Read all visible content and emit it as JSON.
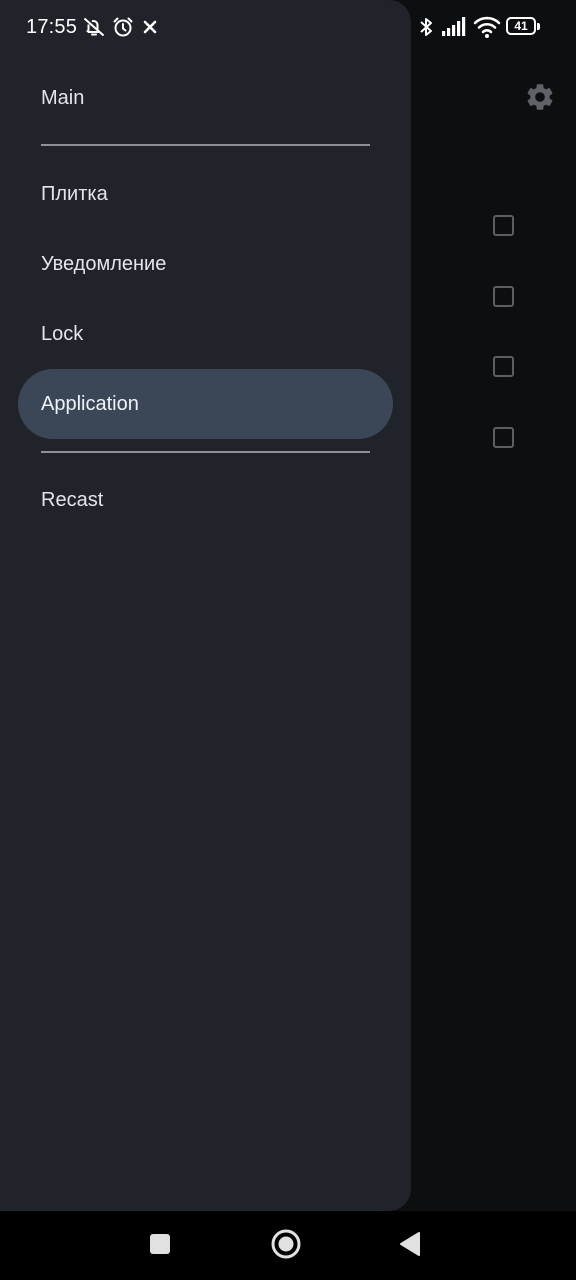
{
  "status_bar": {
    "time": "17:55",
    "battery_level": "41",
    "icons": [
      "muted-bell-icon",
      "alarm-icon",
      "close-x-icon",
      "bluetooth-icon",
      "signal-icon",
      "wifi-icon",
      "battery-icon"
    ]
  },
  "drawer": {
    "items": [
      {
        "label": "Main",
        "active": false
      },
      {
        "label": "Плитка",
        "active": false
      },
      {
        "label": "Уведомление",
        "active": false
      },
      {
        "label": "Lock",
        "active": false
      },
      {
        "label": "Application",
        "active": true
      },
      {
        "label": "Recast",
        "active": false
      }
    ],
    "active_color": "#3b4757",
    "background_color": "#202329"
  },
  "background_app": {
    "icons": [
      "settings-gear-icon"
    ],
    "checkboxes": [
      {
        "checked": false
      },
      {
        "checked": false
      },
      {
        "checked": false
      },
      {
        "checked": false
      }
    ]
  },
  "navigation_bar": {
    "buttons": [
      "recents-square-icon",
      "home-circle-icon",
      "back-triangle-icon"
    ]
  }
}
